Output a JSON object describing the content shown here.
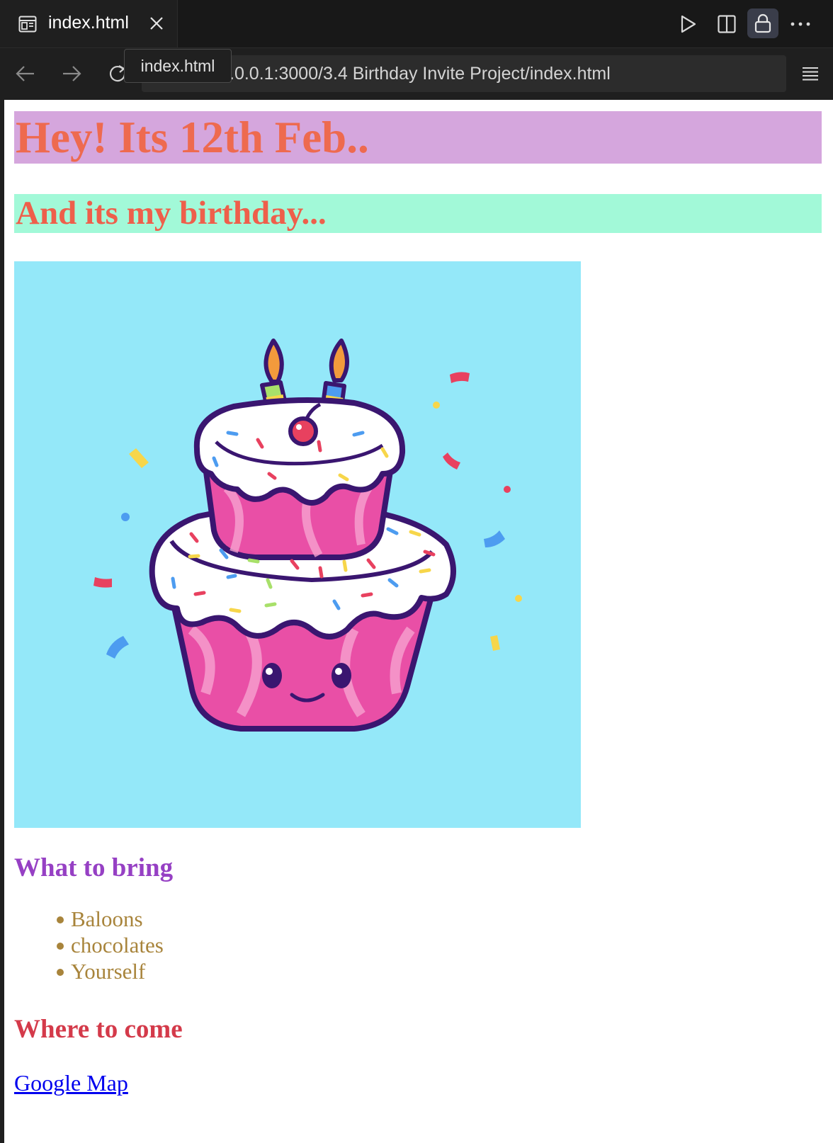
{
  "editor": {
    "tab": {
      "label": "index.html",
      "icon": "preview-file-icon"
    },
    "toolbar_icons": [
      "run-icon",
      "split-editor-icon",
      "lock-icon",
      "more-icon"
    ]
  },
  "browser": {
    "url": ".0.0.1:3000/3.4 Birthday Invite Project/index.html",
    "tooltip": "index.html"
  },
  "page": {
    "heading1": "Hey! Its 12th Feb..",
    "heading2": "And its my birthday...",
    "image": {
      "subject": "cake-illustration",
      "background": "#94e8f9"
    },
    "bring_heading": "What to bring",
    "bring_items": [
      "Baloons",
      "chocolates",
      "Yourself"
    ],
    "where_heading": "Where to come",
    "map_link": "Google Map"
  },
  "colors": {
    "h1_bg": "#d5a6dd",
    "h1_text": "#ee6a4f",
    "h2_bg": "#a2f9d8",
    "h2_text": "#ee5f4b",
    "bring_heading": "#9640c4",
    "list_text": "#a8843b",
    "where_heading": "#d43a4a",
    "link": "#0000ee"
  }
}
